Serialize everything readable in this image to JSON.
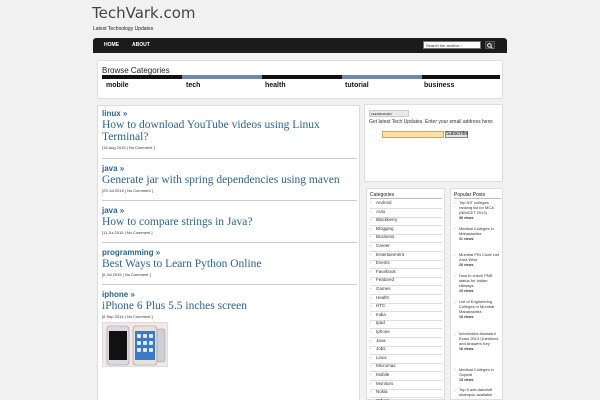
{
  "site": {
    "title": "TechVark.com",
    "tagline": "Latest Technology Updates"
  },
  "nav": {
    "items": [
      "HOME",
      "ABOUT"
    ],
    "search_placeholder": "Search the archive..."
  },
  "browse": {
    "title": "Browse Categories",
    "links": [
      "mobile",
      "tech",
      "health",
      "tutorial",
      "business"
    ]
  },
  "posts": [
    {
      "category": "linux »",
      "title": "How to download YouTube videos using Linux Terminal?",
      "meta": "[16 Aug 2015 | No Comment ]"
    },
    {
      "category": "java »",
      "title": "Generate jar with spring dependencies using maven",
      "meta": "[23 Jul 2015 | No Comment ]"
    },
    {
      "category": "java »",
      "title": "How to compare strings in Java?",
      "meta": "[11 Jul 2015 | No Comment ]"
    },
    {
      "category": "programming »",
      "title": "Best Ways to Learn Python Online",
      "meta": "[6 Jul 2015 | No Comment ]"
    },
    {
      "category": "iphone »",
      "title": "iPhone 6 Plus 5.5 inches screen",
      "meta": "[6 Sep 2014 | No Comment ]"
    }
  ],
  "subscribe": {
    "feed_badge": "FEEDBURNER",
    "text": "Get latest Tech Updates. Enter your email address here:",
    "button": "Subscribe"
  },
  "sidebar": {
    "categories_heading": "Categories",
    "categories": [
      "Android",
      "Auto",
      "Blackberry",
      "Blogging",
      "Business",
      "Career",
      "Entertainment",
      "Events",
      "Facebook",
      "Featured",
      "Games",
      "Health",
      "HTC",
      "India",
      "Ipad",
      "Iphone",
      "Java",
      "Jobs",
      "Linux",
      "Micromax",
      "Mobile",
      "Monitors",
      "Nokia",
      "Others"
    ],
    "popular_heading": "Popular Posts",
    "popular": [
      {
        "title": "Top NIT colleges ranking list for MCA (NIMCET 2013)",
        "views": "36 views"
      },
      {
        "title": "Medical Colleges in Maharashtra",
        "views": "31 views"
      },
      {
        "title": "Mumbai PIN Code List Area Wise",
        "views": "26 views"
      },
      {
        "title": "How to check PNR status for Indian railways",
        "views": "19 views"
      },
      {
        "title": "List of Engineering Colleges in Mumbai Maharashtra",
        "views": "18 views"
      },
      {
        "title": "Informatics Assistant Exam 2013 Questions and Answers Key",
        "views": "16 views"
      },
      {
        "title": "Medical Colleges in Gujarat",
        "views": "15 views"
      },
      {
        "title": "Top 5 anti-dandruff shampoo available",
        "views": ""
      }
    ]
  },
  "colors": {
    "link": "#2a6496",
    "navbar": "#1b1b1b",
    "accent": "#6d8aa8",
    "email_field": "#fde0a6"
  },
  "icons": {
    "search": "search-icon",
    "bullet": "chevron-right-icon"
  }
}
